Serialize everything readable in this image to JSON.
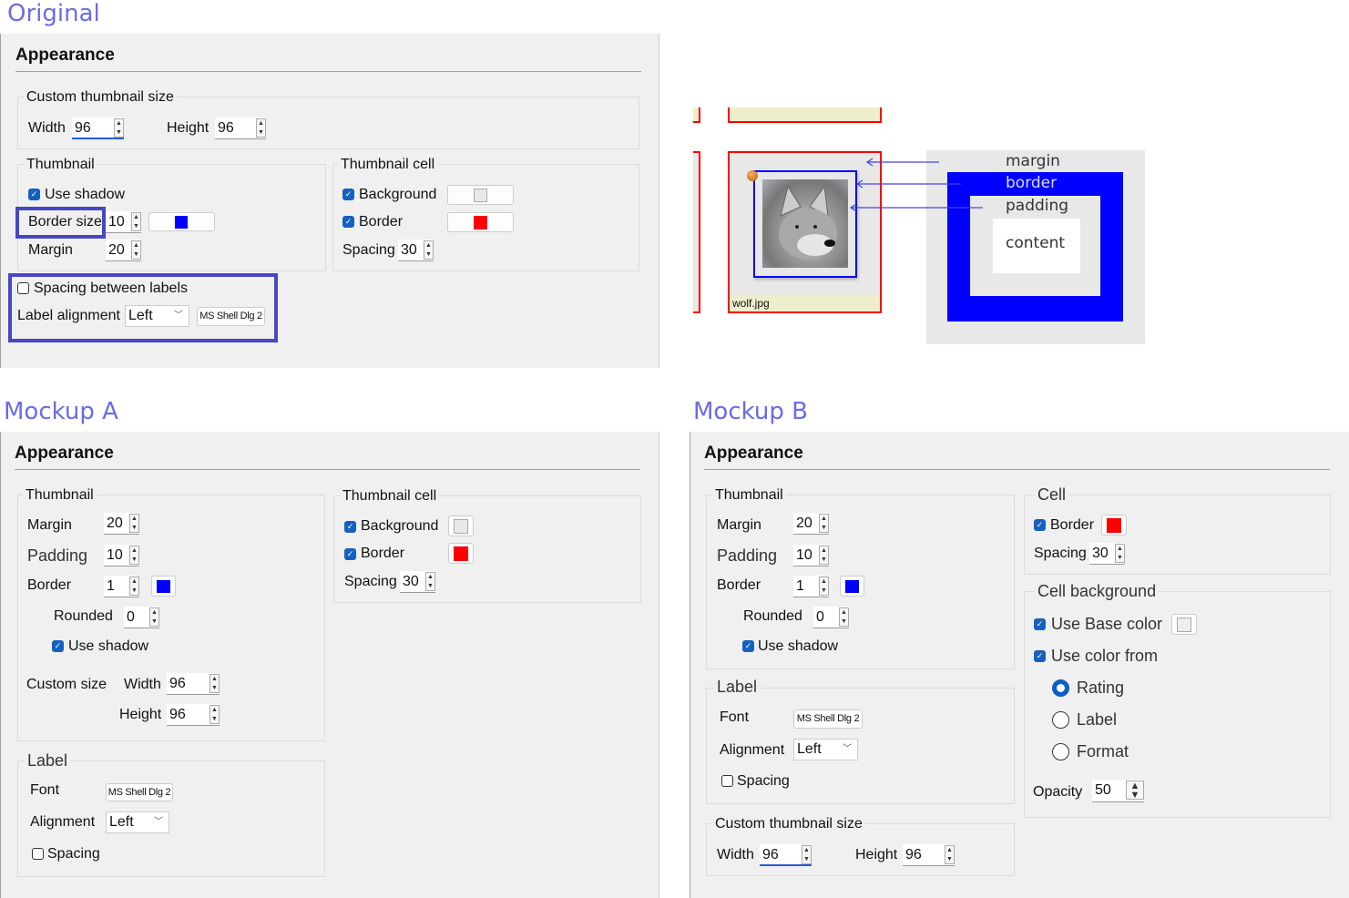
{
  "headings": {
    "original": "Original",
    "mockup_a": "Mockup A",
    "mockup_b": "Mockup B"
  },
  "colors": {
    "accent_highlight": "#4646c8",
    "thumb_border": "#0000ff",
    "cell_border": "#ff0000",
    "cell_background": "#e8e8e8"
  },
  "original": {
    "title": "Appearance",
    "custom_size": {
      "legend": "Custom thumbnail size",
      "width_label": "Width",
      "width": "96",
      "height_label": "Height",
      "height": "96"
    },
    "thumbnail": {
      "legend": "Thumbnail",
      "use_shadow": "Use shadow",
      "border_size_label": "Border size",
      "border_size": "10",
      "margin_label": "Margin",
      "margin": "20"
    },
    "cell": {
      "legend": "Thumbnail cell",
      "background": "Background",
      "border": "Border",
      "spacing_label": "Spacing",
      "spacing": "30"
    },
    "spacing_between_labels": "Spacing between labels",
    "label_alignment_label": "Label alignment",
    "label_alignment": "Left",
    "font": "MS Shell Dlg 2"
  },
  "diagram": {
    "filename": "wolf.jpg",
    "margin": "margin",
    "border": "border",
    "padding": "padding",
    "content": "content"
  },
  "mockup_a": {
    "title": "Appearance",
    "thumbnail": {
      "legend": "Thumbnail",
      "margin_label": "Margin",
      "margin": "20",
      "padding_label": "Padding",
      "padding": "10",
      "border_label": "Border",
      "border": "1",
      "rounded_label": "Rounded",
      "rounded": "0",
      "use_shadow": "Use shadow",
      "custom_size_label": "Custom size",
      "width_label": "Width",
      "width": "96",
      "height_label": "Height",
      "height": "96"
    },
    "label": {
      "legend": "Label",
      "font_label": "Font",
      "font": "MS Shell Dlg 2",
      "alignment_label": "Alignment",
      "alignment": "Left",
      "spacing": "Spacing"
    },
    "cell": {
      "legend": "Thumbnail cell",
      "background": "Background",
      "border": "Border",
      "spacing_label": "Spacing",
      "spacing": "30"
    }
  },
  "mockup_b": {
    "title": "Appearance",
    "thumbnail": {
      "legend": "Thumbnail",
      "margin_label": "Margin",
      "margin": "20",
      "padding_label": "Padding",
      "padding": "10",
      "border_label": "Border",
      "border": "1",
      "rounded_label": "Rounded",
      "rounded": "0",
      "use_shadow": "Use shadow"
    },
    "label": {
      "legend": "Label",
      "font_label": "Font",
      "font": "MS Shell Dlg 2",
      "alignment_label": "Alignment",
      "alignment": "Left",
      "spacing": "Spacing"
    },
    "custom_size": {
      "legend": "Custom thumbnail size",
      "width_label": "Width",
      "width": "96",
      "height_label": "Height",
      "height": "96"
    },
    "cell": {
      "legend": "Cell",
      "border": "Border",
      "spacing_label": "Spacing",
      "spacing": "30"
    },
    "cell_background": {
      "legend": "Cell background",
      "use_base_color": "Use Base color",
      "use_color_from": "Use color from",
      "rating": "Rating",
      "label": "Label",
      "format": "Format",
      "opacity_label": "Opacity",
      "opacity": "50"
    }
  }
}
